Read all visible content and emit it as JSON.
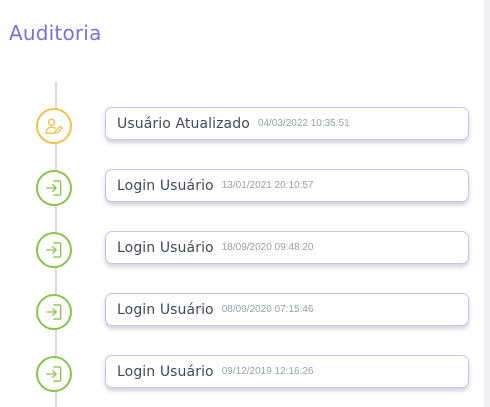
{
  "header": {
    "title": "Auditoria"
  },
  "colors": {
    "title": "#7c6fe0",
    "login_marker": "#8bc34a",
    "edit_marker": "#f2c14e",
    "card_border": "#c9c2f0"
  },
  "timeline": {
    "items": [
      {
        "title": "Usuário Atualizado",
        "datetime": "04/03/2022 10:35:51",
        "icon": "user-edit-icon"
      },
      {
        "title": "Login Usuário",
        "datetime": "13/01/2021 20:10:57",
        "icon": "login-icon"
      },
      {
        "title": "Login Usuário",
        "datetime": "18/09/2020 09:48:20",
        "icon": "login-icon"
      },
      {
        "title": "Login Usuário",
        "datetime": "08/09/2020 07:15:46",
        "icon": "login-icon"
      },
      {
        "title": "Login Usuário",
        "datetime": "09/12/2019 12:16:26",
        "icon": "login-icon"
      }
    ]
  }
}
